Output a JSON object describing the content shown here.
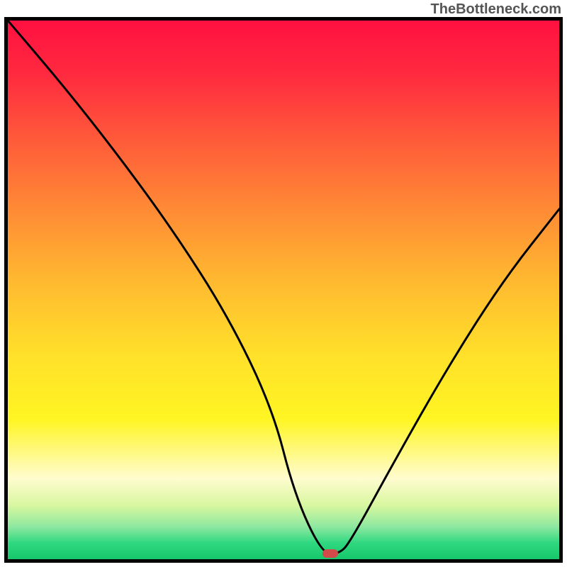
{
  "attribution": "TheBottleneck.com",
  "chart_data": {
    "type": "line",
    "title": "",
    "xlabel": "",
    "ylabel": "",
    "xlim": [
      0,
      100
    ],
    "ylim": [
      0,
      100
    ],
    "series": [
      {
        "name": "curve",
        "x": [
          0,
          10,
          20,
          30,
          40,
          48,
          52,
          57,
          60,
          62,
          70,
          80,
          90,
          100
        ],
        "y": [
          100,
          88,
          75,
          61,
          45,
          28,
          12,
          1,
          1,
          3,
          18,
          36,
          52,
          65
        ]
      }
    ],
    "marker": {
      "x": 58.5,
      "y": 1
    },
    "background_gradient": {
      "top": "#ff1040",
      "mid": "#ffe02a",
      "bottom": "#16c76b"
    }
  }
}
